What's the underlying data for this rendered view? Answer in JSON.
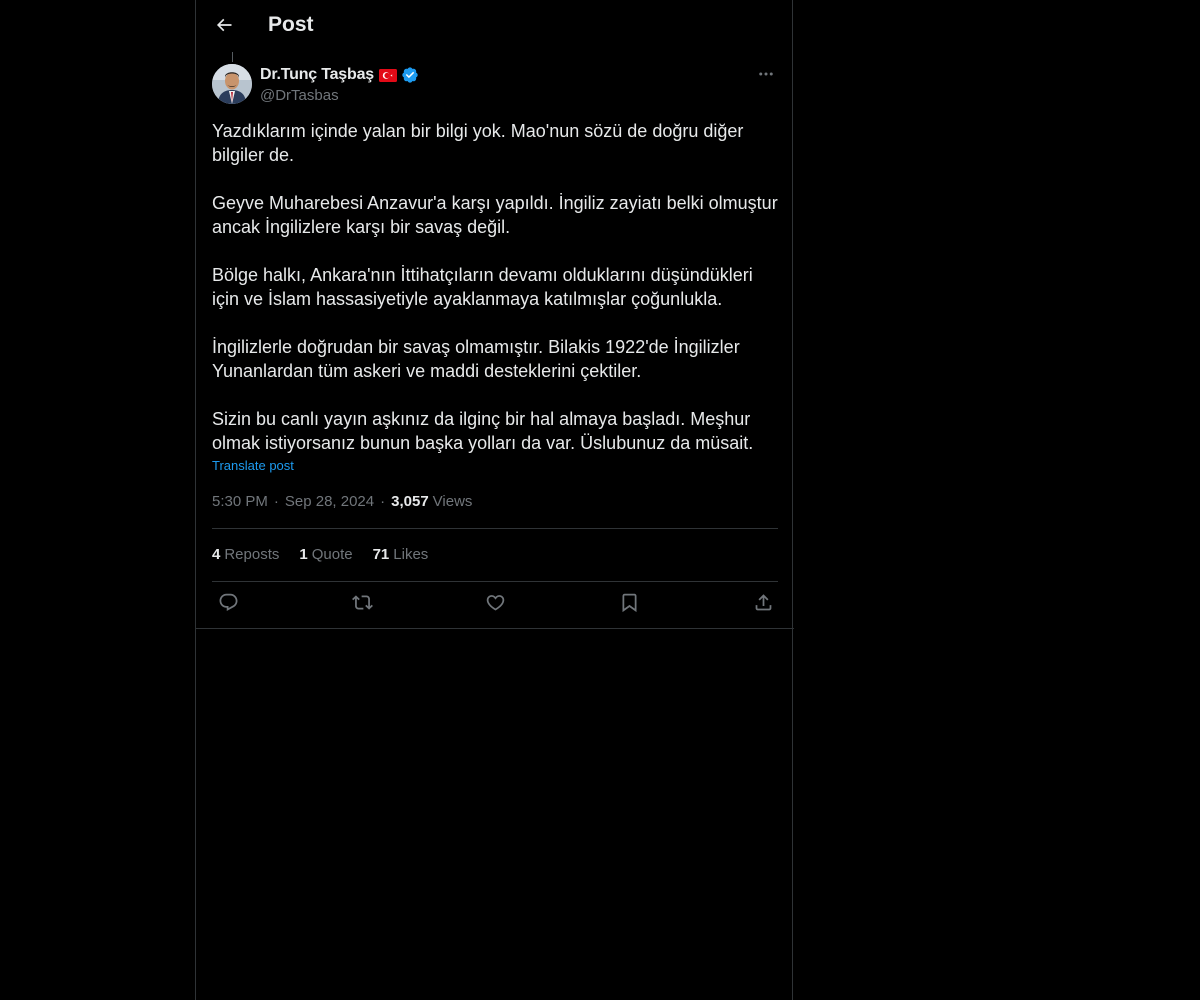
{
  "header": {
    "back_icon": "arrow-left-icon",
    "title": "Post"
  },
  "author": {
    "display_name": "Dr.Tunç Taşbaş",
    "flag_icon": "turkey-flag-icon",
    "verified_icon": "verified-badge-icon",
    "handle": "@DrTasbas",
    "avatar_icon": "avatar"
  },
  "post": {
    "paragraphs": [
      "Yazdıklarım içinde yalan bir bilgi yok. Mao'nun sözü de doğru diğer bilgiler de.",
      "Geyve Muharebesi Anzavur'a karşı yapıldı. İngiliz zayiatı belki olmuştur ancak İngilizlere karşı bir savaş değil.",
      "Bölge halkı, Ankara'nın İttihatçıların devamı olduklarını düşündükleri için ve İslam hassasiyetiyle ayaklanmaya katılmışlar çoğunlukla.",
      "İngilizlerle doğrudan bir savaş olmamıştır. Bilakis 1922'de İngilizler Yunanlardan tüm askeri ve maddi desteklerini çektiler.",
      "Sizin bu canlı yayın aşkınız da ilginç bir hal almaya başladı. Meşhur olmak istiyorsanız bunun başka yolları da var. Üslubunuz da müsait."
    ],
    "translate_label": "Translate post",
    "time": "5:30 PM",
    "date": "Sep 28, 2024",
    "separator": "·",
    "views_count": "3,057",
    "views_label": "Views"
  },
  "stats": {
    "reposts_count": "4",
    "reposts_label": "Reposts",
    "quotes_count": "1",
    "quotes_label": "Quote",
    "likes_count": "71",
    "likes_label": "Likes"
  },
  "actions": [
    {
      "name": "reply",
      "icon": "reply-icon"
    },
    {
      "name": "repost",
      "icon": "repost-icon"
    },
    {
      "name": "like",
      "icon": "heart-icon"
    },
    {
      "name": "bookmark",
      "icon": "bookmark-icon"
    },
    {
      "name": "share",
      "icon": "share-icon"
    }
  ],
  "colors": {
    "background": "#000000",
    "text_primary": "#e7e9ea",
    "text_secondary": "#71767b",
    "link": "#1d9bf0",
    "border": "#2f3336",
    "verified": "#1d9bf0"
  }
}
